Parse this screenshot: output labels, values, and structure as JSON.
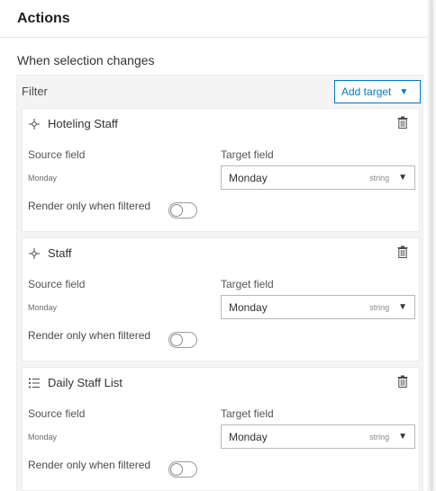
{
  "header": {
    "title": "Actions"
  },
  "section": {
    "label": "When selection changes"
  },
  "filter": {
    "label": "Filter",
    "add_target_label": "Add target"
  },
  "cards": [
    {
      "title": "Hoteling Staff",
      "icon": "point-layer-icon",
      "source_label": "Source field",
      "target_label": "Target field",
      "source_value": "Monday",
      "target_value": "Monday",
      "target_type": "string",
      "render_label": "Render only when filtered",
      "render_only_when_filtered": false
    },
    {
      "title": "Staff",
      "icon": "point-layer-icon",
      "source_label": "Source field",
      "target_label": "Target field",
      "source_value": "Monday",
      "target_value": "Monday",
      "target_type": "string",
      "render_label": "Render only when filtered",
      "render_only_when_filtered": false
    },
    {
      "title": "Daily Staff List",
      "icon": "list-icon",
      "source_label": "Source field",
      "target_label": "Target field",
      "source_value": "Monday",
      "target_value": "Monday",
      "target_type": "string",
      "render_label": "Render only when filtered",
      "render_only_when_filtered": false
    }
  ],
  "colors": {
    "accent": "#007ac2",
    "panel_bg": "#f4f4f4",
    "text": "#323232"
  }
}
